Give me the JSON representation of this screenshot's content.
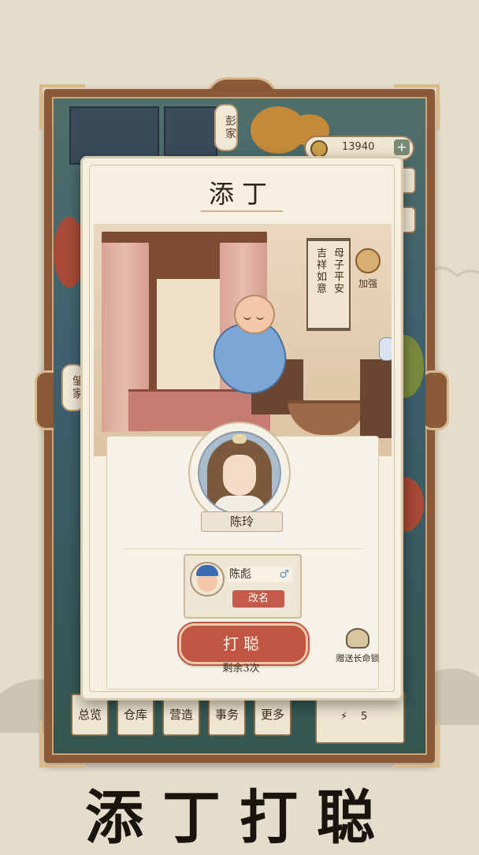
{
  "map": {
    "family_label_top": "彭家",
    "family_label_left": "邹家",
    "coins": "13940",
    "plus": "+"
  },
  "bottom_tabs": [
    "总览",
    "仓库",
    "营造",
    "事务",
    "更多"
  ],
  "stat_box": {
    "value": "5"
  },
  "dialog": {
    "title": "添丁",
    "scroll_right": "母子平安",
    "scroll_left": "吉祥如意",
    "enhance_label": "加强",
    "mother_name": "陈玲",
    "child_name": "陈彪",
    "child_gender": "♂",
    "rename_label": "改名",
    "main_button": "打聪",
    "remaining": "剩余3次",
    "gift_label": "赠送长命锁"
  },
  "banner": "添丁打聪",
  "colors": {
    "frame": "#8a5a38",
    "dialog_bg": "#f5efe2",
    "main_button": "#c25644",
    "rename_button": "#c65a4a"
  }
}
